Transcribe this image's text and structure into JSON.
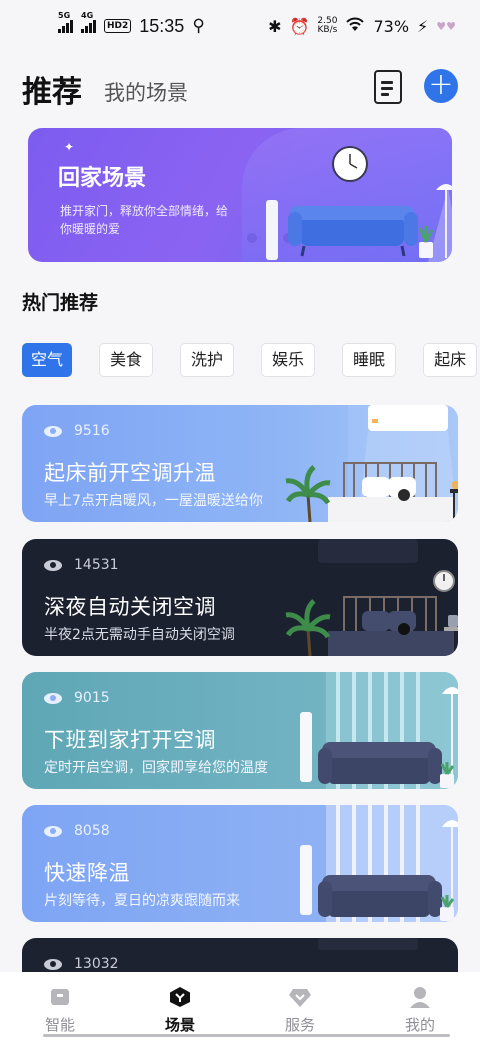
{
  "status_bar": {
    "signal1_label": "5G",
    "signal2_label": "4G",
    "hd_badge": "HD2",
    "time": "15:35",
    "speed_value": "2.50",
    "speed_unit": "KB/s",
    "battery": "73%"
  },
  "header": {
    "tabs": [
      {
        "label": "推荐",
        "active": true
      },
      {
        "label": "我的场景",
        "active": false
      }
    ],
    "doc_icon": "document-icon",
    "add_icon": "plus-icon"
  },
  "banner": {
    "title": "回家场景",
    "description": "推开家门，释放你全部情绪，给你暖暖的爱"
  },
  "hot_section": {
    "title": "热门推荐",
    "chips": [
      "空气",
      "美食",
      "洗护",
      "娱乐",
      "睡眠",
      "起床"
    ],
    "active_chip": "空气"
  },
  "scenes": [
    {
      "views": "9516",
      "title": "起床前开空调升温",
      "desc": "早上7点开启暖风，一屋温暖送给你"
    },
    {
      "views": "14531",
      "title": "深夜自动关闭空调",
      "desc": "半夜2点无需动手自动关闭空调"
    },
    {
      "views": "9015",
      "title": "下班到家打开空调",
      "desc": "定时开启空调，回家即享给您的温度"
    },
    {
      "views": "8058",
      "title": "快速降温",
      "desc": "片刻等待，夏日的凉爽跟随而来"
    },
    {
      "views": "13032",
      "title": "",
      "desc": ""
    }
  ],
  "bottom_nav": [
    {
      "label": "智能",
      "icon": "device-icon",
      "active": false
    },
    {
      "label": "场景",
      "icon": "scene-hexagon-icon",
      "active": true
    },
    {
      "label": "服务",
      "icon": "diamond-icon",
      "active": false
    },
    {
      "label": "我的",
      "icon": "person-icon",
      "active": false
    }
  ],
  "colors": {
    "accent": "#2f74e8",
    "banner_purple": "#7c5cf0",
    "card_blue": "#7ea4f4",
    "card_dark": "#1c2130",
    "card_teal": "#5fa7b6"
  }
}
